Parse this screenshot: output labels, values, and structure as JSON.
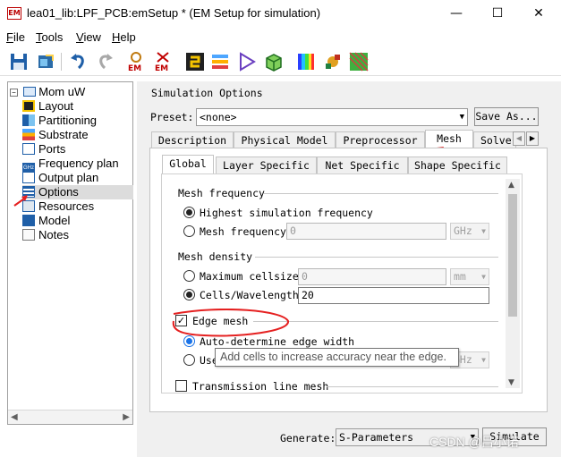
{
  "window": {
    "app_icon": "EM",
    "title": "lea01_lib:LPF_PCB:emSetup * (EM Setup for simulation)",
    "minimize": "—",
    "maximize": "☐",
    "close": "✕"
  },
  "menu": [
    {
      "accel": "F",
      "rest": "ile"
    },
    {
      "accel": "T",
      "rest": "ools"
    },
    {
      "accel": "V",
      "rest": "iew"
    },
    {
      "accel": "H",
      "rest": "elp"
    }
  ],
  "toolbar_icons": [
    "save-icon",
    "open-icon",
    "undo-icon",
    "redo-icon",
    "em-simulate-icon",
    "em-stop-icon",
    "layout-icon",
    "layers-icon",
    "play-icon",
    "3d-box-icon",
    "color-bar-icon",
    "component-icon",
    "mesh-view-icon"
  ],
  "toolbar_labels": {
    "em1": "EM",
    "em2": "EM"
  },
  "tree": {
    "root": "Mom uW",
    "items": [
      {
        "label": "Layout",
        "icon": "layout-icon"
      },
      {
        "label": "Partitioning",
        "icon": "partitioning-icon"
      },
      {
        "label": "Substrate",
        "icon": "substrate-icon"
      },
      {
        "label": "Ports",
        "icon": "ports-icon"
      },
      {
        "label": "Frequency plan",
        "icon": "ghz-icon"
      },
      {
        "label": "Output plan",
        "icon": "output-plan-icon"
      },
      {
        "label": "Options",
        "icon": "options-icon",
        "selected": true
      },
      {
        "label": "Resources",
        "icon": "resources-icon"
      },
      {
        "label": "Model",
        "icon": "model-icon"
      },
      {
        "label": "Notes",
        "icon": "notes-icon"
      }
    ],
    "ghz_text": "GHz"
  },
  "options": {
    "section_title": "Simulation Options",
    "preset_label": "Preset:",
    "preset_value": "<none>",
    "save_as_label": "Save As...",
    "tabs": [
      "Description",
      "Physical Model",
      "Preprocessor",
      "Mesh",
      "Solve"
    ],
    "active_tab": "Mesh",
    "subtabs": [
      "Global",
      "Layer Specific",
      "Net Specific",
      "Shape Specific"
    ],
    "active_subtab": "Global",
    "mesh_frequency": {
      "title": "Mesh frequency",
      "highest_label": "Highest simulation frequency",
      "highest_selected": true,
      "custom_label": "Mesh frequency",
      "custom_value": "0",
      "custom_unit": "GHz"
    },
    "mesh_density": {
      "title": "Mesh density",
      "max_cellsize_label": "Maximum cellsize",
      "max_cellsize_value": "0",
      "max_cellsize_unit": "mm",
      "cells_wavelength_label": "Cells/Wavelength",
      "cells_wavelength_value": "20",
      "cells_wavelength_selected": true
    },
    "edge_mesh": {
      "label": "Edge mesh",
      "checked": true,
      "auto_label": "Auto-determine edge width",
      "auto_selected": true,
      "user_label": "Use",
      "user_unit": "GHz"
    },
    "transmission_line_mesh_label": "Transmission line mesh",
    "tooltip": "Add cells to increase accuracy near the edge.",
    "generate_label": "Generate:",
    "generate_value": "S-Parameters",
    "simulate_label": "Simulate"
  },
  "annotation_color": "#e52020",
  "watermark": "CSDN @吕小诺"
}
